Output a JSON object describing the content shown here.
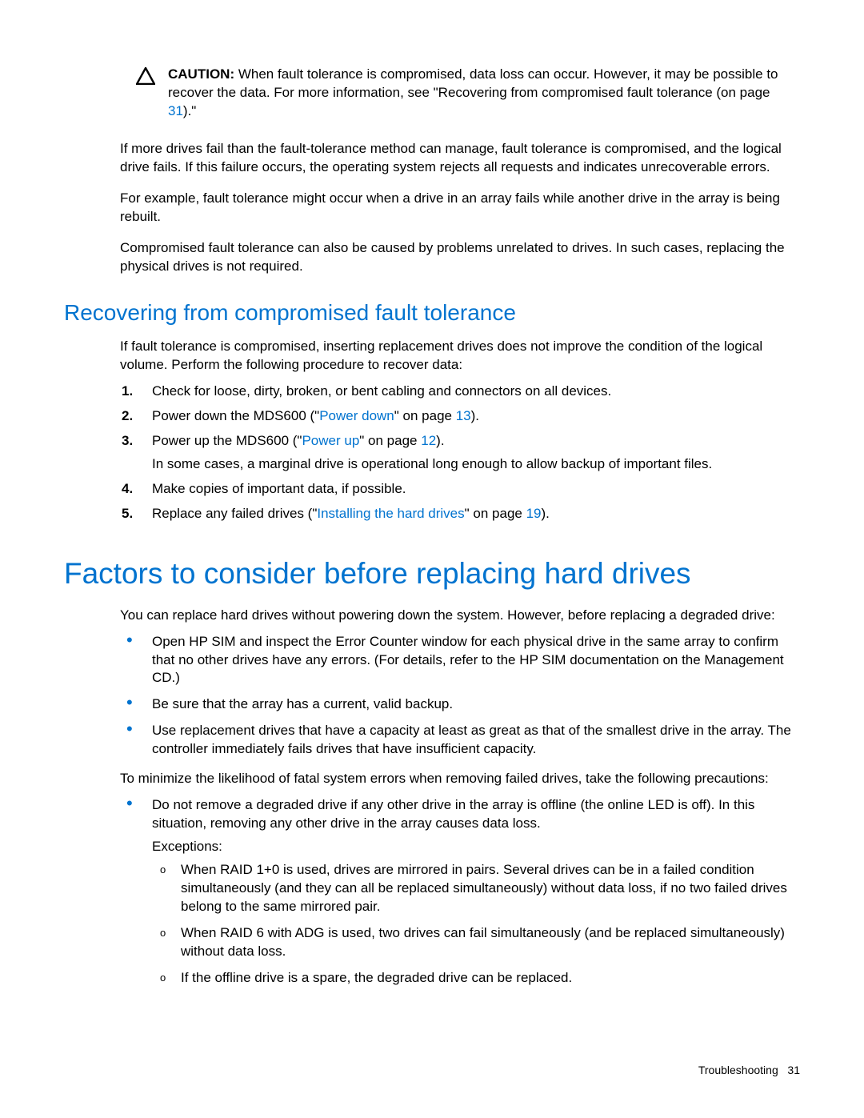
{
  "caution": {
    "label": "CAUTION:",
    "t1": "When fault tolerance is compromised, data loss can occur. However, it may be possible to recover the data. For more information, see \"Recovering from compromised fault tolerance (on page ",
    "link": "31",
    "t2": ").\""
  },
  "p1": "If more drives fail than the fault-tolerance method can manage, fault tolerance is compromised, and the logical drive fails. If this failure occurs, the operating system rejects all requests and indicates unrecoverable errors.",
  "p2": "For example, fault tolerance might occur when a drive in an array fails while another drive in the array is being rebuilt.",
  "p3": "Compromised fault tolerance can also be caused by problems unrelated to drives. In such cases, replacing the physical drives is not required.",
  "h2_recovering": "Recovering from compromised fault tolerance",
  "rec_intro": "If fault tolerance is compromised, inserting replacement drives does not improve the condition of the logical volume. Perform the following procedure to recover data:",
  "steps": {
    "s1": "Check for loose, dirty, broken, or bent cabling and connectors on all devices.",
    "s2a": "Power down the MDS600 (\"",
    "s2link": "Power down",
    "s2b": "\" on page ",
    "s2page": "13",
    "s2c": ").",
    "s3a": "Power up the MDS600 (\"",
    "s3link": "Power up",
    "s3b": "\" on page ",
    "s3page": "12",
    "s3c": ").",
    "s3_sub": "In some cases, a marginal drive is operational long enough to allow backup of important files.",
    "s4": "Make copies of important data, if possible.",
    "s5a": "Replace any failed drives (\"",
    "s5link": "Installing the hard drives",
    "s5b": "\" on page ",
    "s5page": "19",
    "s5c": ")."
  },
  "h1_factors": "Factors to consider before replacing hard drives",
  "fac_intro": "You can replace hard drives without powering down the system. However, before replacing a degraded drive:",
  "fac_b1": "Open HP SIM and inspect the Error Counter window for each physical drive in the same array to confirm that no other drives have any errors. (For details, refer to the HP SIM documentation on the Management CD.)",
  "fac_b2": "Be sure that the array has a current, valid backup.",
  "fac_b3": "Use replacement drives that have a capacity at least as great as that of the smallest drive in the array. The controller immediately fails drives that have insufficient capacity.",
  "fac_mid": "To minimize the likelihood of fatal system errors when removing failed drives, take the following precautions:",
  "fac2_b1": "Do not remove a degraded drive if any other drive in the array is offline (the online LED is off). In this situation, removing any other drive in the array causes data loss.",
  "exceptions_label": "Exceptions:",
  "exc1": "When RAID 1+0 is used, drives are mirrored in pairs. Several drives can be in a failed condition simultaneously (and they can all be replaced simultaneously) without data loss, if no two failed drives belong to the same mirrored pair.",
  "exc2": "When RAID 6 with ADG is used, two drives can fail simultaneously (and be replaced simultaneously) without data loss.",
  "exc3": "If the offline drive is a spare, the degraded drive can be replaced.",
  "footer": {
    "section": "Troubleshooting",
    "page": "31"
  }
}
